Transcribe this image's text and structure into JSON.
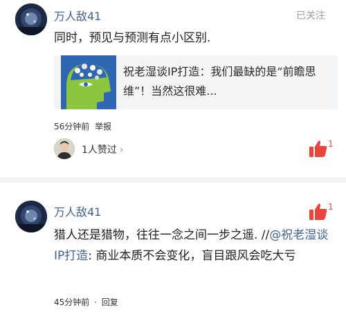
{
  "colors": {
    "link": "#41608e",
    "like_red": "#e8453c",
    "meta_gray": "#9a9a9a"
  },
  "comments": [
    {
      "username": "万人敌41",
      "follow_status": "已关注",
      "text": "同时，预见与预测有点小区别.",
      "share_card": {
        "title": "祝老湿谈IP打造：我们最缺的是“前瞻思维”！当然这很难...",
        "thumbnail_icon": "head-gears-icon"
      },
      "time": "56分钟前",
      "report_label": "举报",
      "likers_text": "1人赞过",
      "like_count": "1",
      "like_icon": "thumbs-up-icon"
    },
    {
      "username": "万人敌41",
      "text_main": "猎人还是猎物，往往一念之间一步之遥. //",
      "mention": "@祝老湿谈IP打造",
      "quote_text": ": 商业本质不会变化，盲目跟风会吃大亏",
      "time": "45分钟前",
      "separator": "·",
      "reply_label": "回复",
      "like_count": "1",
      "like_icon": "thumbs-up-icon"
    }
  ]
}
